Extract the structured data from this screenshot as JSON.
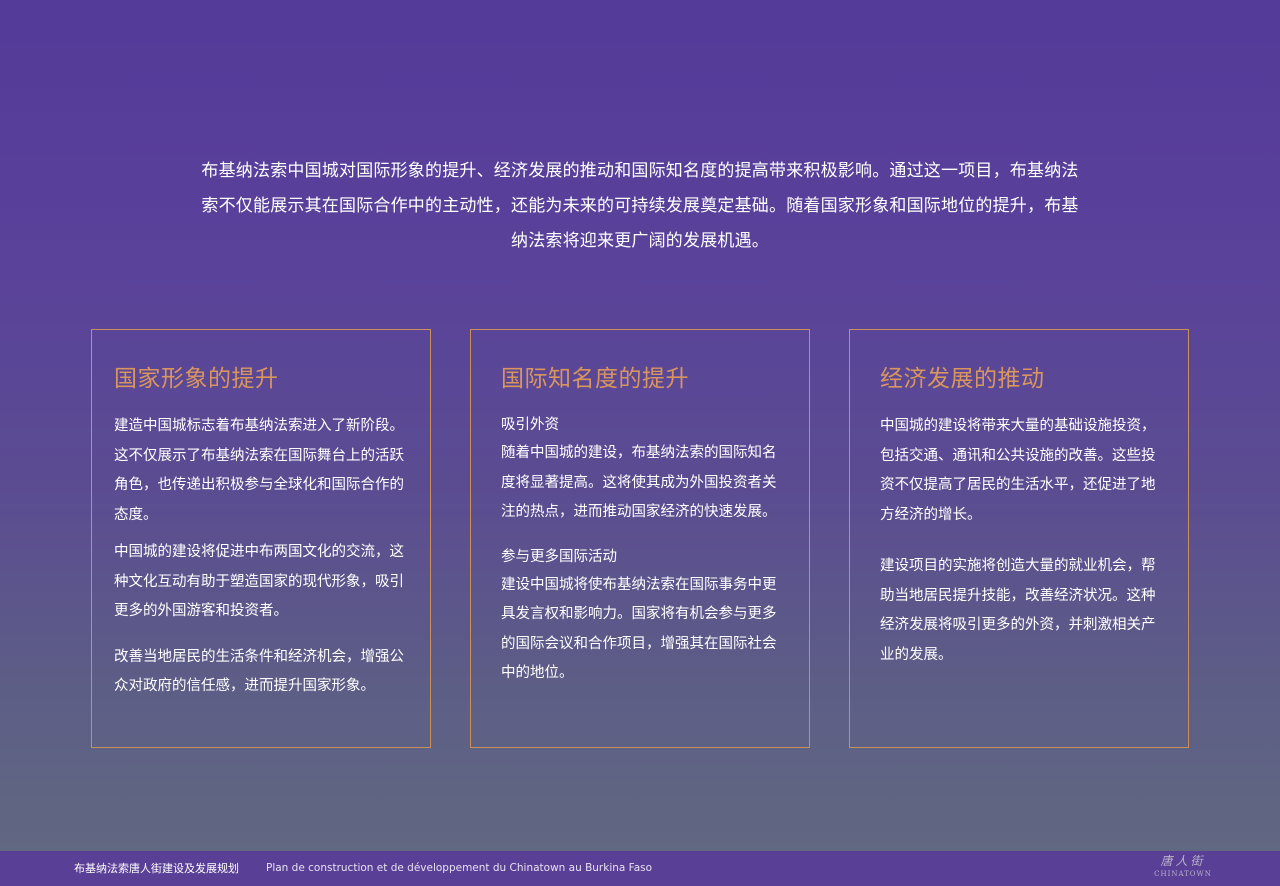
{
  "intro": {
    "line1": "布基纳法索中国城对国际形象的提升、经济发展的推动和国际知名度的提高带来积极影响。通过这一项目，布基纳法",
    "line2": "索不仅能展示其在国际合作中的主动性，还能为未来的可持续发展奠定基础。随着国家形象和国际地位的提升，布基",
    "line3": "纳法索将迎来更广阔的发展机遇。"
  },
  "cards": [
    {
      "title": "国家形象的提升",
      "paragraphs": [
        "建造中国城标志着布基纳法索进入了新阶段。这不仅展示了布基纳法索在国际舞台上的活跃角色，也传递出积极参与全球化和国际合作的态度。",
        "中国城的建设将促进中布两国文化的交流，这种文化互动有助于塑造国家的现代形象，吸引更多的外国游客和投资者。",
        "改善当地居民的生活条件和经济机会，增强公众对政府的信任感，进而提升国家形象。"
      ]
    },
    {
      "title": "国际知名度的提升",
      "sections": [
        {
          "heading": "吸引外资",
          "body": "随着中国城的建设，布基纳法索的国际知名度将显著提高。这将使其成为外国投资者关注的热点，进而推动国家经济的快速发展。"
        },
        {
          "heading": "参与更多国际活动",
          "body": "建设中国城将使布基纳法索在国际事务中更具发言权和影响力。国家将有机会参与更多的国际会议和合作项目，增强其在国际社会中的地位。"
        }
      ]
    },
    {
      "title": "经济发展的推动",
      "paragraphs": [
        "中国城的建设将带来大量的基础设施投资，包括交通、通讯和公共设施的改善。这些投资不仅提高了居民的生活水平，还促进了地方经济的增长。",
        "建设项目的实施将创造大量的就业机会，帮助当地居民提升技能，改善经济状况。这种经济发展将吸引更多的外资，并刺激相关产业的发展。"
      ]
    }
  ],
  "footer": {
    "title_cn": "布基纳法索唐人街建设及发展规划",
    "title_fr": "Plan de construction et de développement du Chinatown au Burkina Faso",
    "logo_cn": "唐人街",
    "logo_en": "CHINATOWN"
  },
  "colors": {
    "accent": "#D8965E",
    "border": "#C9905A",
    "footer_bg": "#5A3F97"
  }
}
